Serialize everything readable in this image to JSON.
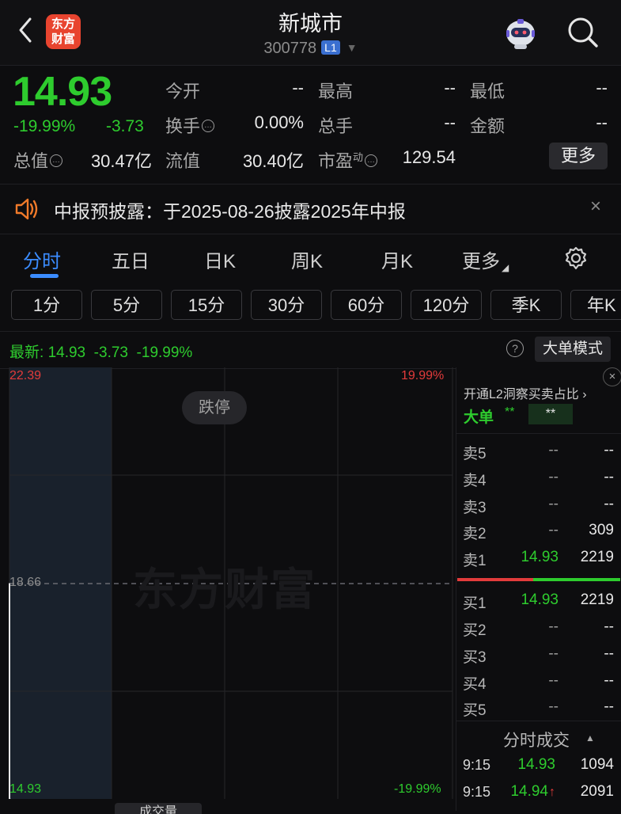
{
  "header": {
    "back_icon": "chevron-left-icon",
    "logo_text": "东方财富",
    "title": "新城市",
    "code": "300778",
    "level_badge": "L1",
    "robot_icon": "robot-assistant-icon",
    "search_icon": "search-icon"
  },
  "quote": {
    "price": "14.93",
    "change_pct": "-19.99%",
    "change": "-3.73",
    "fields": {
      "open_label": "今开",
      "open_value": "--",
      "high_label": "最高",
      "high_value": "--",
      "low_label": "最低",
      "low_value": "--",
      "turnover_label": "换手",
      "turnover_value": "0.00%",
      "volume_label": "总手",
      "volume_value": "--",
      "amount_label": "金额",
      "amount_value": "--",
      "mktcap_label": "总值",
      "mktcap_value": "30.47亿",
      "float_label": "流值",
      "float_value": "30.40亿",
      "pe_label": "市盈",
      "pe_sup": "动",
      "pe_value": "129.54"
    },
    "more_label": "更多"
  },
  "notice": {
    "text": "中报预披露：于2025-08-26披露2025年中报",
    "close_label": "×"
  },
  "tabs": {
    "items": [
      "分时",
      "五日",
      "日K",
      "周K",
      "月K",
      "更多"
    ],
    "active": "分时"
  },
  "subtabs": [
    "1分",
    "5分",
    "15分",
    "30分",
    "60分",
    "120分",
    "季K",
    "年K"
  ],
  "latest": {
    "label": "最新:",
    "price": "14.93",
    "change": "-3.73",
    "pct": "-19.99%",
    "help": "?",
    "mode_button": "大单模式"
  },
  "chart": {
    "limit_label": "跌停",
    "watermark": "东方财富",
    "y_top": "22.39",
    "y_mid": "18.66",
    "y_bot": "14.93",
    "pct_top": "19.99%",
    "pct_bot": "-19.99%",
    "bottom_tab": "成交量"
  },
  "chart_data": {
    "type": "line",
    "title": "",
    "y_axis": {
      "max": 22.39,
      "prev_close": 18.66,
      "min": 14.93
    },
    "pct_axis": {
      "max": "19.99%",
      "min": "-19.99%"
    },
    "series": [
      {
        "x": [
          "9:15",
          "9:15"
        ],
        "values": [
          14.93,
          14.94
        ]
      }
    ],
    "grid": true
  },
  "panel": {
    "close_label": "×",
    "l2_text": "开通L2洞察买卖占比 ›",
    "big_label": "大单",
    "big_v1": "**",
    "big_v2": "**",
    "sell": [
      {
        "label": "卖5",
        "price": "--",
        "vol": "--"
      },
      {
        "label": "卖4",
        "price": "--",
        "vol": "--"
      },
      {
        "label": "卖3",
        "price": "--",
        "vol": "--"
      },
      {
        "label": "卖2",
        "price": "--",
        "vol": "309"
      },
      {
        "label": "卖1",
        "price": "14.93",
        "vol": "2219"
      }
    ],
    "buy": [
      {
        "label": "买1",
        "price": "14.93",
        "vol": "2219"
      },
      {
        "label": "买2",
        "price": "--",
        "vol": "--"
      },
      {
        "label": "买3",
        "price": "--",
        "vol": "--"
      },
      {
        "label": "买4",
        "price": "--",
        "vol": "--"
      },
      {
        "label": "买5",
        "price": "--",
        "vol": "--"
      }
    ],
    "ticks_title": "分时成交",
    "ticks": [
      {
        "time": "9:15",
        "price": "14.93",
        "vol": "1094",
        "up": ""
      },
      {
        "time": "9:15",
        "price": "14.94",
        "vol": "2091",
        "up": "↑"
      }
    ]
  },
  "colors": {
    "down": "#2ecc2e",
    "up": "#e23b3b",
    "accent": "#3b8cff",
    "background": "#0d0d0f"
  }
}
